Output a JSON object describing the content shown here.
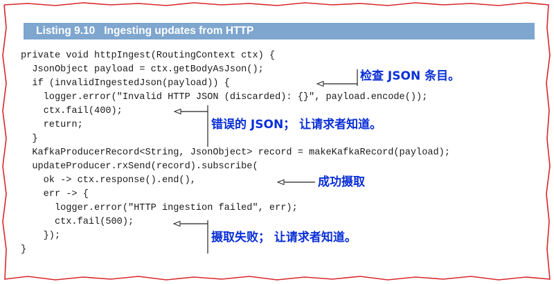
{
  "listing": {
    "number": "Listing 9.10",
    "title": "Ingesting updates from HTTP"
  },
  "code_lines": [
    "private void httpIngest(RoutingContext ctx) {",
    "  JsonObject payload = ctx.getBodyAsJson();",
    "  if (invalidIngestedJson(payload)) {",
    "    logger.error(\"Invalid HTTP JSON (discarded): {}\", payload.encode());",
    "    ctx.fail(400);",
    "    return;",
    "  }",
    "  KafkaProducerRecord<String, JsonObject> record = makeKafkaRecord(payload);",
    "  updateProducer.rxSend(record).subscribe(",
    "    ok -> ctx.response().end(),",
    "    err -> {",
    "      logger.error(\"HTTP ingestion failed\", err);",
    "      ctx.fail(500);",
    "    });",
    "}"
  ],
  "annotations": {
    "check_json": "检查 JSON 条目。",
    "bad_json": "错误的 JSON；  让请求者知道。",
    "success": "成功摄取",
    "failure": "摄取失败；  让请求者知道。"
  },
  "colors": {
    "border": "#d8262a",
    "header_bg": "#7ea6cf",
    "annotation": "#0a2fd6"
  }
}
